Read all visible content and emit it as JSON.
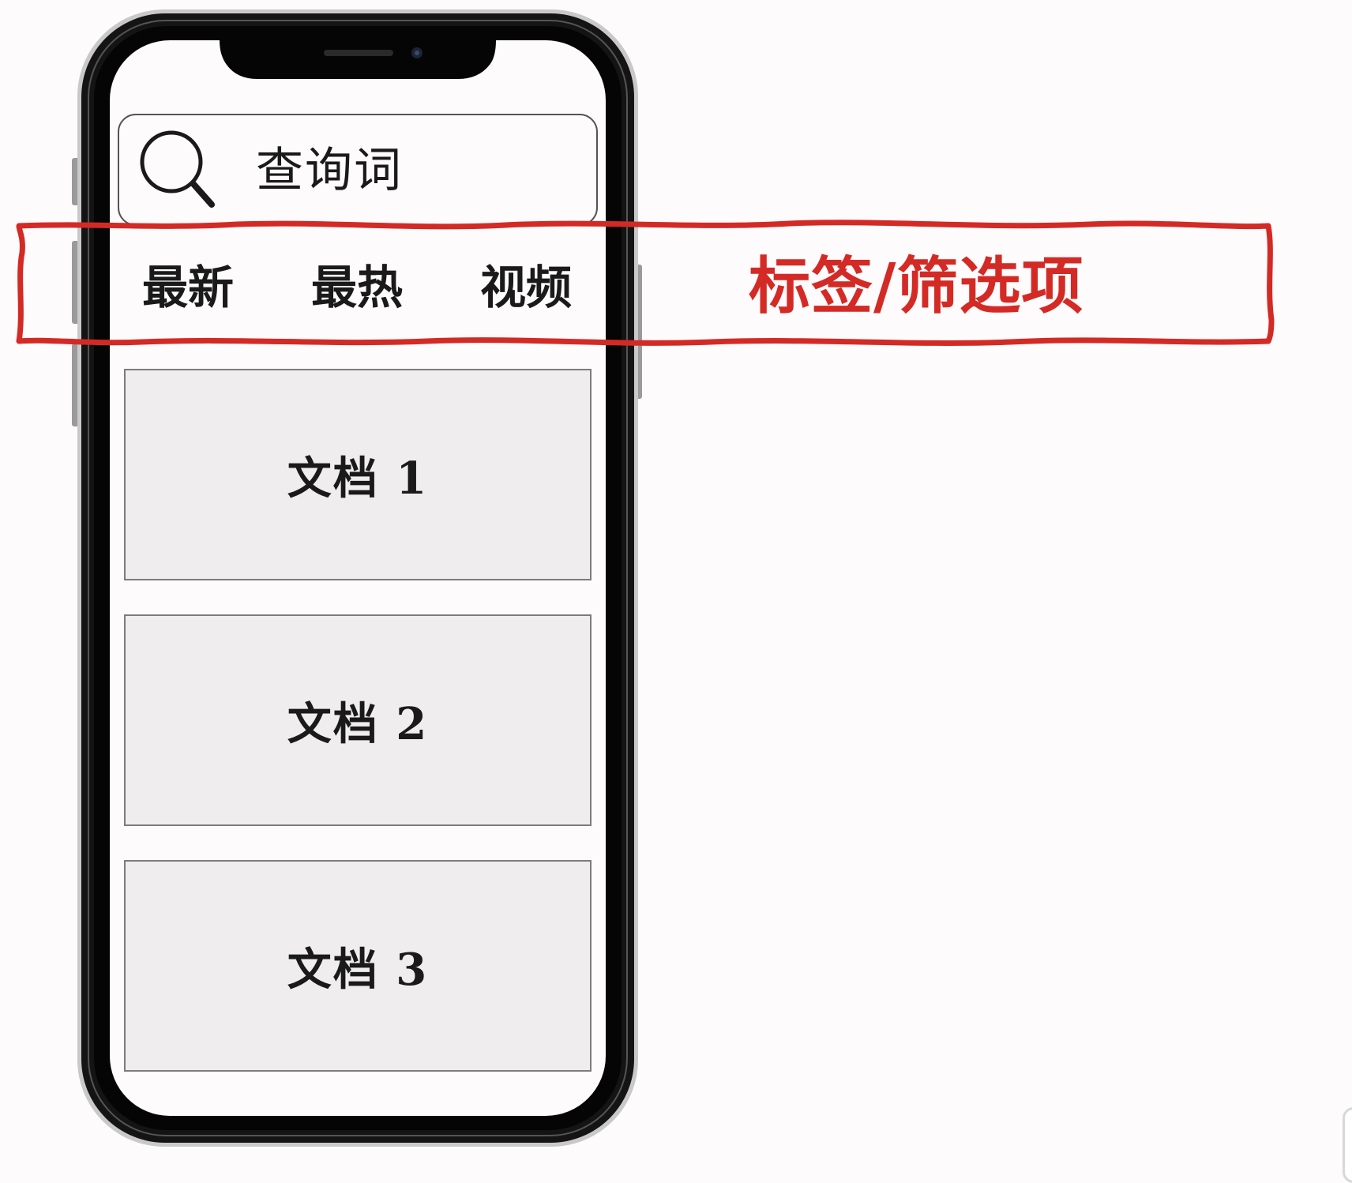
{
  "search": {
    "query": "查询词"
  },
  "tabs": [
    {
      "label": "最新"
    },
    {
      "label": "最热"
    },
    {
      "label": "视频"
    }
  ],
  "documents": [
    {
      "label": "文档 1"
    },
    {
      "label": "文档 2"
    },
    {
      "label": "文档 3"
    }
  ],
  "annotation": {
    "label": "标签/筛选项",
    "color": "#d42a25"
  },
  "icons": {
    "search": "search-icon"
  },
  "colors": {
    "background": "#fdfbfc",
    "phone_frame": "#111111",
    "card_background": "#efedee",
    "annotation_red": "#d42a25"
  }
}
